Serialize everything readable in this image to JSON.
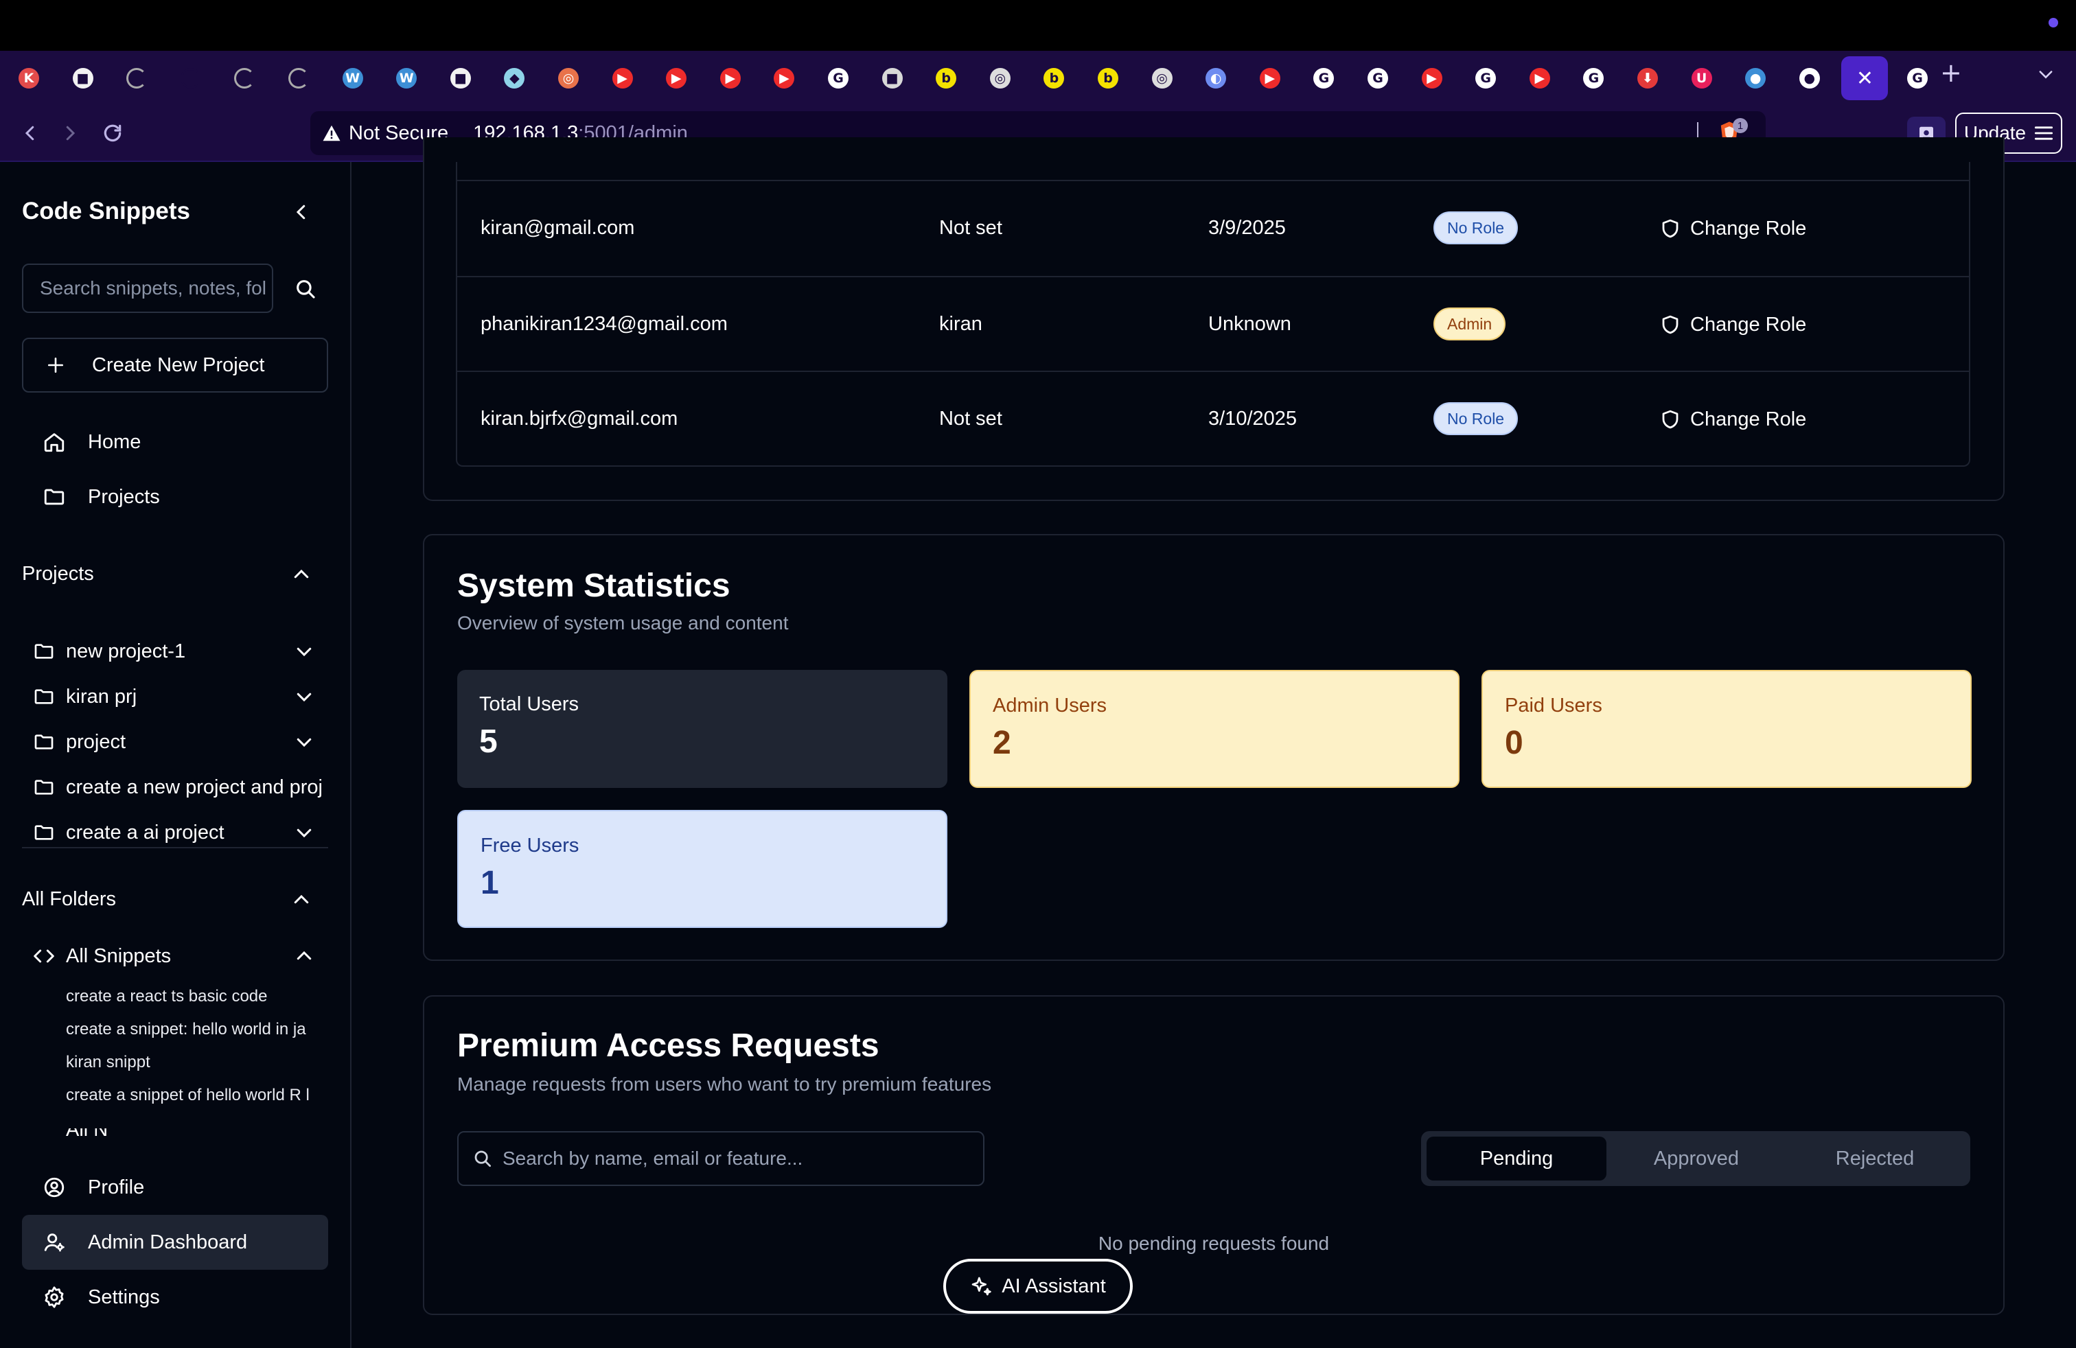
{
  "browser": {
    "url_host": "192.168.1.3",
    "url_path": ":5001/admin",
    "security_label": "Not Secure",
    "update_label": "Update",
    "shield_badge": "1",
    "tab_icons": [
      {
        "name": "karma-tab",
        "glyph": "K",
        "color": "#e34b4b"
      },
      {
        "name": "app-tab",
        "glyph": "■",
        "color": "#f2f2f2"
      },
      {
        "name": "loading-tab",
        "glyph": "",
        "color": "#aaa"
      },
      {
        "name": "empty-tab",
        "glyph": "",
        "color": "#1b0b40"
      },
      {
        "name": "loading-tab",
        "glyph": "",
        "color": "#aaa"
      },
      {
        "name": "loading-tab",
        "glyph": "",
        "color": "#aaa"
      },
      {
        "name": "wordpress-tab",
        "glyph": "W",
        "color": "#3d8fd6"
      },
      {
        "name": "wordpress-tab",
        "glyph": "W",
        "color": "#3d8fd6"
      },
      {
        "name": "app-tab",
        "glyph": "■",
        "color": "#f2f2f2"
      },
      {
        "name": "app-tab",
        "glyph": "◆",
        "color": "#8fd3e8"
      },
      {
        "name": "target-tab",
        "glyph": "◎",
        "color": "#e8724a"
      },
      {
        "name": "youtube-tab",
        "glyph": "▶",
        "color": "#ee2b2b"
      },
      {
        "name": "youtube-tab",
        "glyph": "▶",
        "color": "#ee2b2b"
      },
      {
        "name": "youtube-tab",
        "glyph": "▶",
        "color": "#ee2b2b"
      },
      {
        "name": "youtube-tab",
        "glyph": "▶",
        "color": "#ee2b2b"
      },
      {
        "name": "google-tab",
        "glyph": "G",
        "color": "#ffffff"
      },
      {
        "name": "app-tab",
        "glyph": "■",
        "color": "#d8d8d8"
      },
      {
        "name": "bing-tab",
        "glyph": "b",
        "color": "#f4e200"
      },
      {
        "name": "openai-tab",
        "glyph": "◎",
        "color": "#dddddd"
      },
      {
        "name": "bing-tab",
        "glyph": "b",
        "color": "#f4e200"
      },
      {
        "name": "bing-tab",
        "glyph": "b",
        "color": "#f4e200"
      },
      {
        "name": "openai-tab",
        "glyph": "◎",
        "color": "#dddddd"
      },
      {
        "name": "app-tab",
        "glyph": "◐",
        "color": "#6e8cf0"
      },
      {
        "name": "youtube-tab",
        "glyph": "▶",
        "color": "#ee2b2b"
      },
      {
        "name": "google-tab",
        "glyph": "G",
        "color": "#ffffff"
      },
      {
        "name": "google-tab",
        "glyph": "G",
        "color": "#ffffff"
      },
      {
        "name": "youtube-tab",
        "glyph": "▶",
        "color": "#ee2b2b"
      },
      {
        "name": "google-tab",
        "glyph": "G",
        "color": "#ffffff"
      },
      {
        "name": "youtube-tab",
        "glyph": "▶",
        "color": "#ee2b2b"
      },
      {
        "name": "google-tab",
        "glyph": "G",
        "color": "#ffffff"
      },
      {
        "name": "download-tab",
        "glyph": "⬇",
        "color": "#e33a3a"
      },
      {
        "name": "app-tab",
        "glyph": "U",
        "color": "#e8205c"
      },
      {
        "name": "app-tab",
        "glyph": "●",
        "color": "#3d8fd6"
      },
      {
        "name": "github-tab",
        "glyph": "●",
        "color": "#ffffff"
      },
      {
        "name": "active-tab",
        "glyph": "✕",
        "color": "#4b23c8"
      },
      {
        "name": "google-tab",
        "glyph": "G",
        "color": "#ffffff"
      }
    ]
  },
  "sidebar": {
    "title": "Code Snippets",
    "search_placeholder": "Search snippets, notes, folders...",
    "create_label": "Create New Project",
    "nav": [
      {
        "label": "Home"
      },
      {
        "label": "Projects"
      }
    ],
    "projects_heading": "Projects",
    "projects": [
      {
        "label": "new project-1",
        "expandable": true
      },
      {
        "label": "kiran prj",
        "expandable": true
      },
      {
        "label": "project",
        "expandable": true
      },
      {
        "label": "create a new project and proj",
        "expandable": false
      },
      {
        "label": "create a ai project",
        "expandable": true
      }
    ],
    "folders_heading": "All Folders",
    "all_snippets_label": "All Snippets",
    "snippets": [
      "create a react ts basic code",
      "create a snippet: hello world in ja",
      "kiran snippt",
      "create a snippet of hello world R l"
    ],
    "partial_item": "All N",
    "bottom_nav": [
      {
        "label": "Profile"
      },
      {
        "label": "Admin Dashboard"
      },
      {
        "label": "Settings"
      }
    ]
  },
  "users_table": {
    "rows": [
      {
        "email": "kiran@gmail.com",
        "name": "Not set",
        "joined": "3/9/2025",
        "role": "No Role",
        "action": "Change Role"
      },
      {
        "email": "phanikiran1234@gmail.com",
        "name": "kiran",
        "joined": "Unknown",
        "role": "Admin",
        "action": "Change Role"
      },
      {
        "email": "kiran.bjrfx@gmail.com",
        "name": "Not set",
        "joined": "3/10/2025",
        "role": "No Role",
        "action": "Change Role"
      }
    ]
  },
  "stats": {
    "title": "System Statistics",
    "subtitle": "Overview of system usage and content",
    "cards": [
      {
        "label": "Total Users",
        "value": "5"
      },
      {
        "label": "Admin Users",
        "value": "2"
      },
      {
        "label": "Paid Users",
        "value": "0"
      },
      {
        "label": "Free Users",
        "value": "1"
      }
    ]
  },
  "premium": {
    "title": "Premium Access Requests",
    "subtitle": "Manage requests from users who want to try premium features",
    "search_placeholder": "Search by name, email or feature...",
    "tabs": [
      "Pending",
      "Approved",
      "Rejected"
    ],
    "active_tab": "Pending",
    "empty_text": "No pending requests found"
  },
  "ai_button_label": "AI Assistant",
  "colors": {
    "accent": "#4b23c8",
    "chrome": "#1b0b40",
    "background": "#030711",
    "admin_badge": "#fdf1c7",
    "norole_badge": "#dbe6fb"
  }
}
